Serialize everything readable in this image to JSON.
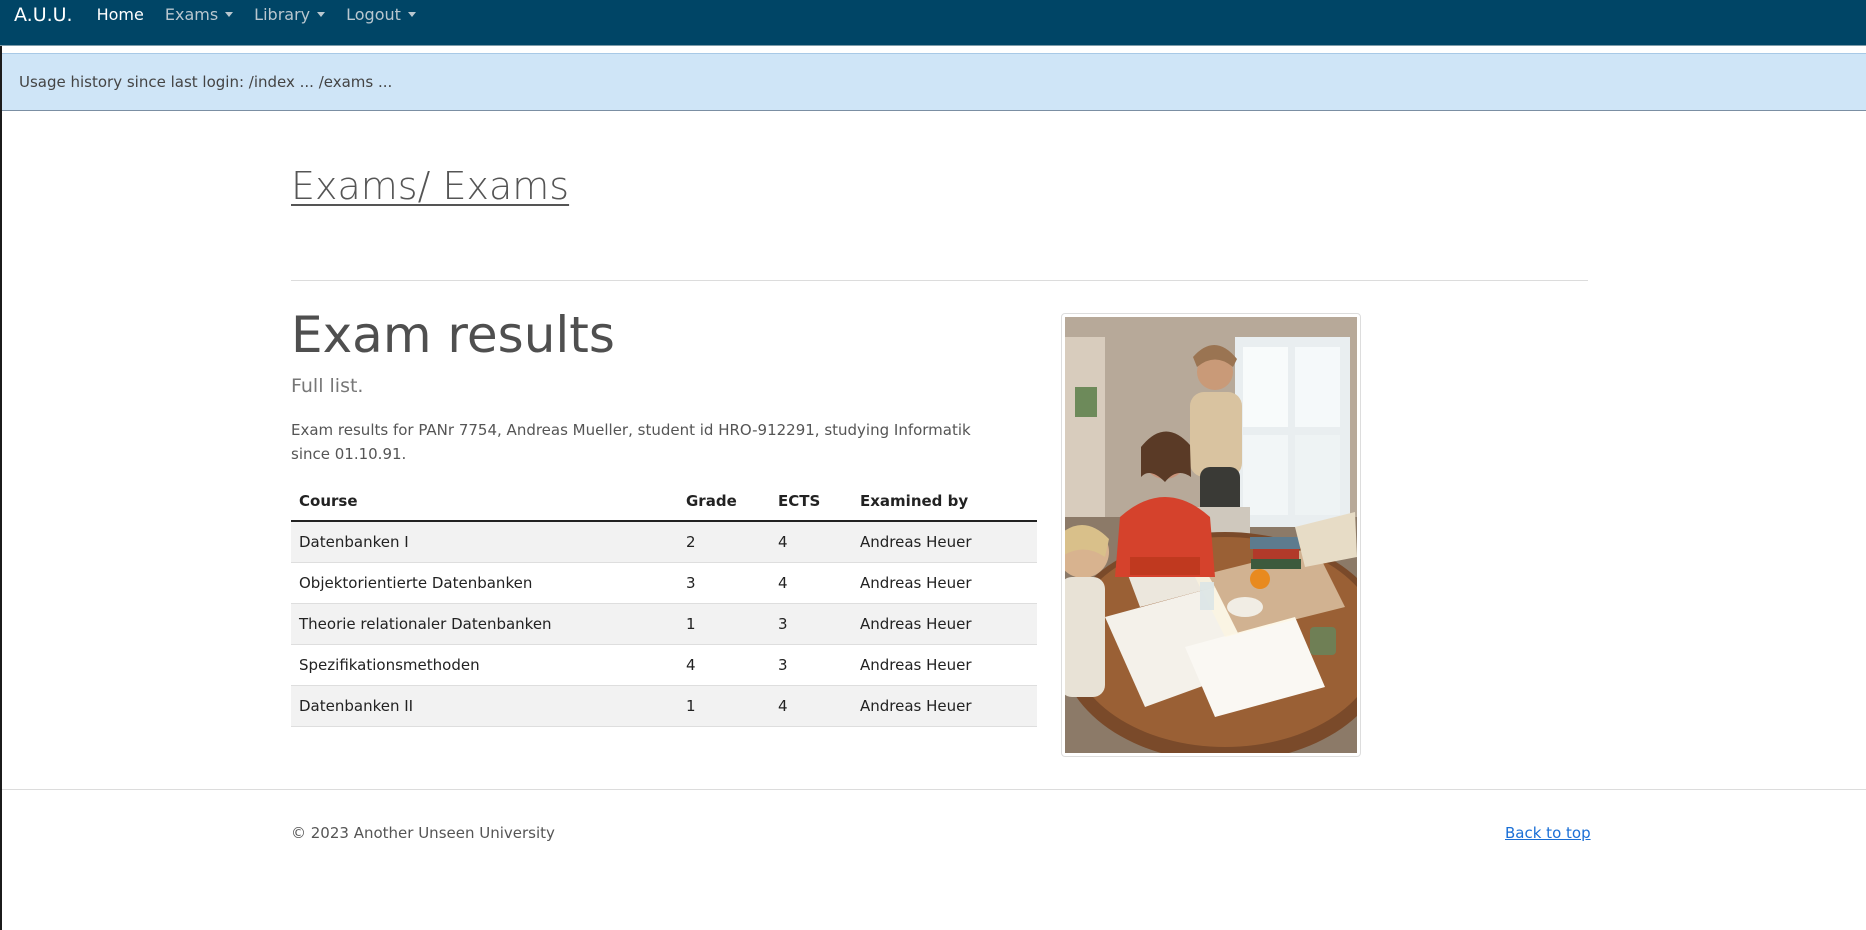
{
  "navbar": {
    "brand": "A.U.U.",
    "items": [
      {
        "label": "Home",
        "active": true,
        "dropdown": false
      },
      {
        "label": "Exams",
        "active": false,
        "dropdown": true
      },
      {
        "label": "Library",
        "active": false,
        "dropdown": true
      },
      {
        "label": "Logout",
        "active": false,
        "dropdown": true
      }
    ]
  },
  "alert": {
    "text": "Usage history since last login: /index ... /exams ..."
  },
  "page": {
    "title": "Exams/ Exams"
  },
  "content": {
    "heading": "Exam results",
    "lead": "Full list.",
    "description": "Exam results for PANr 7754, Andreas Mueller, student id HRO-912291, studying Informatik since 01.10.91."
  },
  "table": {
    "headers": [
      "Course",
      "Grade",
      "ECTS",
      "Examined by"
    ],
    "rows": [
      [
        "Datenbanken I",
        "2",
        "4",
        "Andreas Heuer"
      ],
      [
        "Objektorientierte Datenbanken",
        "3",
        "4",
        "Andreas Heuer"
      ],
      [
        "Theorie relationaler Datenbanken",
        "1",
        "3",
        "Andreas Heuer"
      ],
      [
        "Spezifikationsmethoden",
        "4",
        "3",
        "Andreas Heuer"
      ],
      [
        "Datenbanken II",
        "1",
        "4",
        "Andreas Heuer"
      ]
    ]
  },
  "image": {
    "subject": "students-studying-photo"
  },
  "footer": {
    "copyright": "© 2023 Another Unseen University",
    "back_to_top": "Back to top"
  },
  "colors": {
    "navbar_bg": "#004566",
    "alert_bg": "#cfe5f7",
    "link": "#1a6fd6"
  }
}
